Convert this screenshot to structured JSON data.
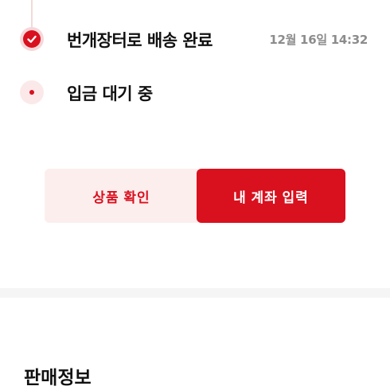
{
  "timeline": {
    "steps": [
      {
        "label": "번개장터로 배송 완료",
        "time": "12월 16일 14:32",
        "status": "done"
      },
      {
        "label": "입금 대기 중",
        "status": "pending"
      }
    ]
  },
  "actions": {
    "check_product_label": "상품 확인",
    "enter_account_label": "내 계좌 입력"
  },
  "section": {
    "title": "판매정보"
  },
  "colors": {
    "accent": "#d9101e",
    "accent_light": "#fdeeee",
    "muted_text": "#8c8c8c"
  }
}
